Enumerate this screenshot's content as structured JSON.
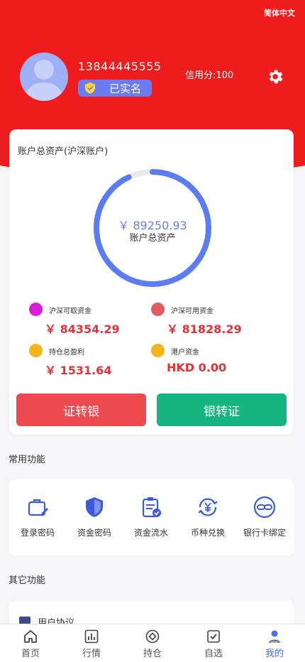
{
  "header": {
    "language": "简体中文",
    "phone": "13844445555",
    "verified_label": "已实名",
    "credit": "信用分:100"
  },
  "assets": {
    "title": "账户总资产(沪深账户)",
    "total_amount": "￥ 89250.93",
    "total_label": "账户总资产",
    "ring_progress": 0.93,
    "stats": [
      {
        "label": "沪深可取资金",
        "value": "￥ 84354.29",
        "color": "#d61fd6"
      },
      {
        "label": "沪深可用资金",
        "value": "￥ 81828.29",
        "color": "#e65a66"
      },
      {
        "label": "持仓总盈利",
        "value": "￥ 1531.64",
        "color": "#f3b51a"
      },
      {
        "label": "港户资金",
        "value": "HKD 0.00",
        "color": "#f3b51a"
      }
    ],
    "btn_out": "证转银",
    "btn_in": "银转证"
  },
  "common": {
    "title": "常用功能",
    "items": [
      {
        "label": "登录密码",
        "icon": "briefcase-edit-icon"
      },
      {
        "label": "资金密码",
        "icon": "shield-icon"
      },
      {
        "label": "资金流水",
        "icon": "clipboard-check-icon"
      },
      {
        "label": "币种兑换",
        "icon": "currency-exchange-icon"
      },
      {
        "label": "银行卡绑定",
        "icon": "chain-link-icon"
      }
    ]
  },
  "other": {
    "title": "其它功能",
    "first_item": "用户协议"
  },
  "tabs": [
    {
      "label": "首页",
      "icon": "home-icon"
    },
    {
      "label": "行情",
      "icon": "chart-icon"
    },
    {
      "label": "持仓",
      "icon": "target-icon"
    },
    {
      "label": "自选",
      "icon": "checkbox-icon"
    },
    {
      "label": "我的",
      "icon": "user-icon",
      "active": true
    }
  ],
  "colors": {
    "header_red": "#ee1c1c",
    "accent_blue": "#4e6ef2",
    "value_red": "#e2333b",
    "btn_red": "#ec4a4e",
    "btn_green": "#16b47f"
  }
}
